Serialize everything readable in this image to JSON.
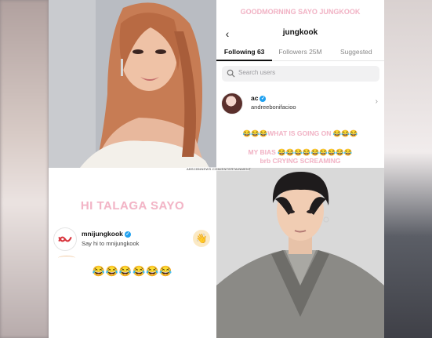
{
  "following_screen": {
    "caption": "GOODMORNING SAYO JUNGKOOK",
    "title": "jungkook",
    "tabs": [
      {
        "label": "Following 63",
        "active": true
      },
      {
        "label": "Followers 25M",
        "active": false
      },
      {
        "label": "Suggested",
        "active": false
      }
    ],
    "search_placeholder": "Search users",
    "user": {
      "name": "ac",
      "handle": "andreebonifacioo",
      "verified": true
    },
    "reaction_line1": "😂😂😂WHAT IS GOING ON 😂😂😂",
    "reaction_line2": "MY BIAS 😂😂😂😂😂😂😂😂😂",
    "reaction_line3": "brb CRYING SCREAMING"
  },
  "watermark": "ABSCBNNEWS.COM/ENTERTAINMENT",
  "message_screen": {
    "caption": "HI TALAGA SAYO",
    "contact_name": "mnijungkook",
    "contact_verified": true,
    "contact_sub": "Say hi to mnijungkook",
    "emoji_line": "😂😂😂😂😂😂"
  },
  "icons": {
    "back": "back-arrow-icon",
    "search": "search-icon",
    "verified": "verified-badge-icon",
    "chevron": "chevron-right-icon",
    "wave": "waving-hand-icon"
  },
  "colors": {
    "caption_pink": "#f3b4c6",
    "verified_blue": "#20a1f0"
  }
}
